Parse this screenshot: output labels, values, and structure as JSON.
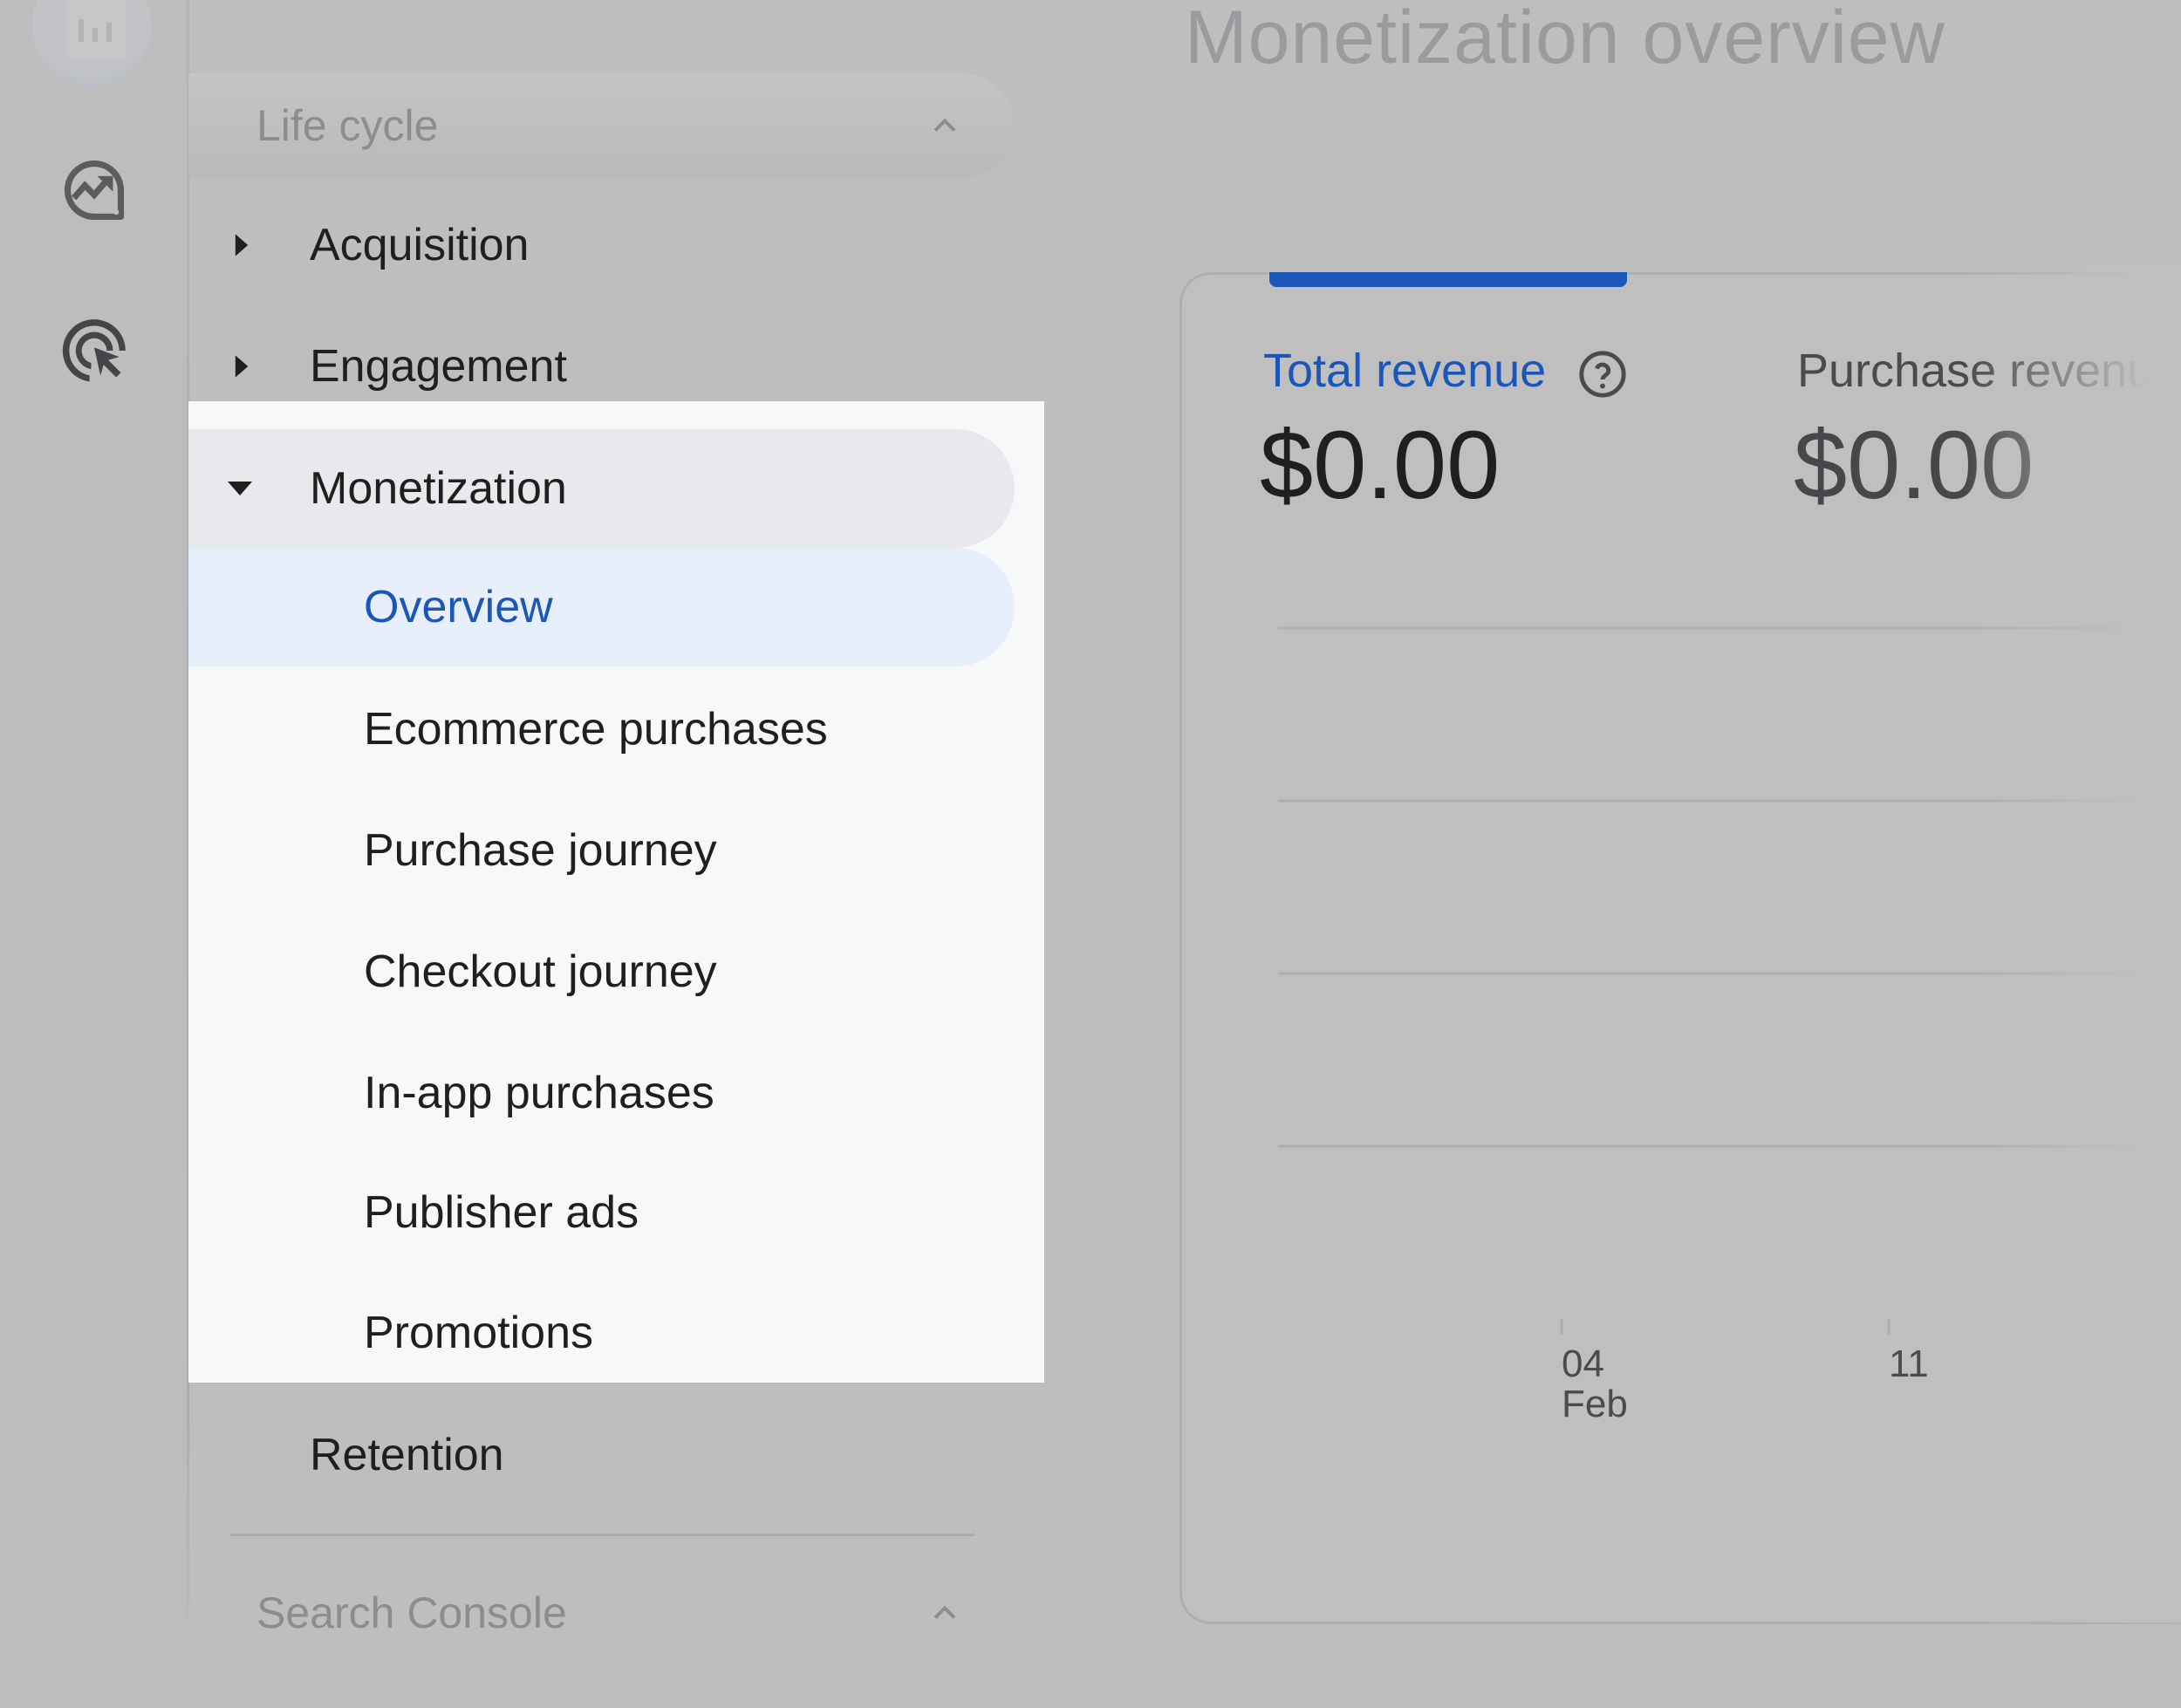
{
  "page": {
    "title": "Monetization overview"
  },
  "rail": {
    "icons": [
      {
        "name": "reports-icon"
      },
      {
        "name": "explore-icon"
      },
      {
        "name": "advertising-icon"
      }
    ]
  },
  "nav": {
    "lifecycle": {
      "label": "Life cycle",
      "chevron": "chevron-up-icon"
    },
    "acquisition": {
      "label": "Acquisition"
    },
    "engagement": {
      "label": "Engagement"
    },
    "monetization": {
      "label": "Monetization",
      "expanded": true,
      "items": [
        {
          "label": "Overview",
          "active": true
        },
        {
          "label": "Ecommerce purchases"
        },
        {
          "label": "Purchase journey"
        },
        {
          "label": "Checkout journey"
        },
        {
          "label": "In-app purchases"
        },
        {
          "label": "Publisher ads"
        },
        {
          "label": "Promotions"
        }
      ]
    },
    "retention": {
      "label": "Retention"
    },
    "search_console": {
      "label": "Search Console",
      "chevron": "chevron-up-icon"
    }
  },
  "card": {
    "metrics": [
      {
        "label": "Total revenue",
        "value": "$0.00",
        "selected": true
      },
      {
        "label": "Purchase revenue",
        "value": "$0.00",
        "selected": false
      }
    ]
  },
  "colors": {
    "accent": "#1a57b8",
    "active_bg": "#e8effc",
    "expanded_bg": "#e8e9ec",
    "spotlight_bg": "#f7f8fa",
    "overlay_bg": "#bdbebd"
  },
  "chart_data": {
    "type": "line",
    "title": "",
    "xlabel": "",
    "ylabel": "",
    "x_ticks": [
      {
        "label": "04",
        "sublabel": "Feb"
      },
      {
        "label": "11",
        "sublabel": ""
      }
    ],
    "series": [
      {
        "name": "Total revenue",
        "values": [
          0,
          0,
          0,
          0,
          0,
          0,
          0,
          0,
          0,
          0,
          0,
          0,
          0,
          0,
          0,
          0,
          0,
          0,
          0,
          0
        ],
        "color": "#1a57b8"
      }
    ],
    "ylim": [
      0,
      4
    ],
    "gridlines": 4,
    "grid": true
  }
}
